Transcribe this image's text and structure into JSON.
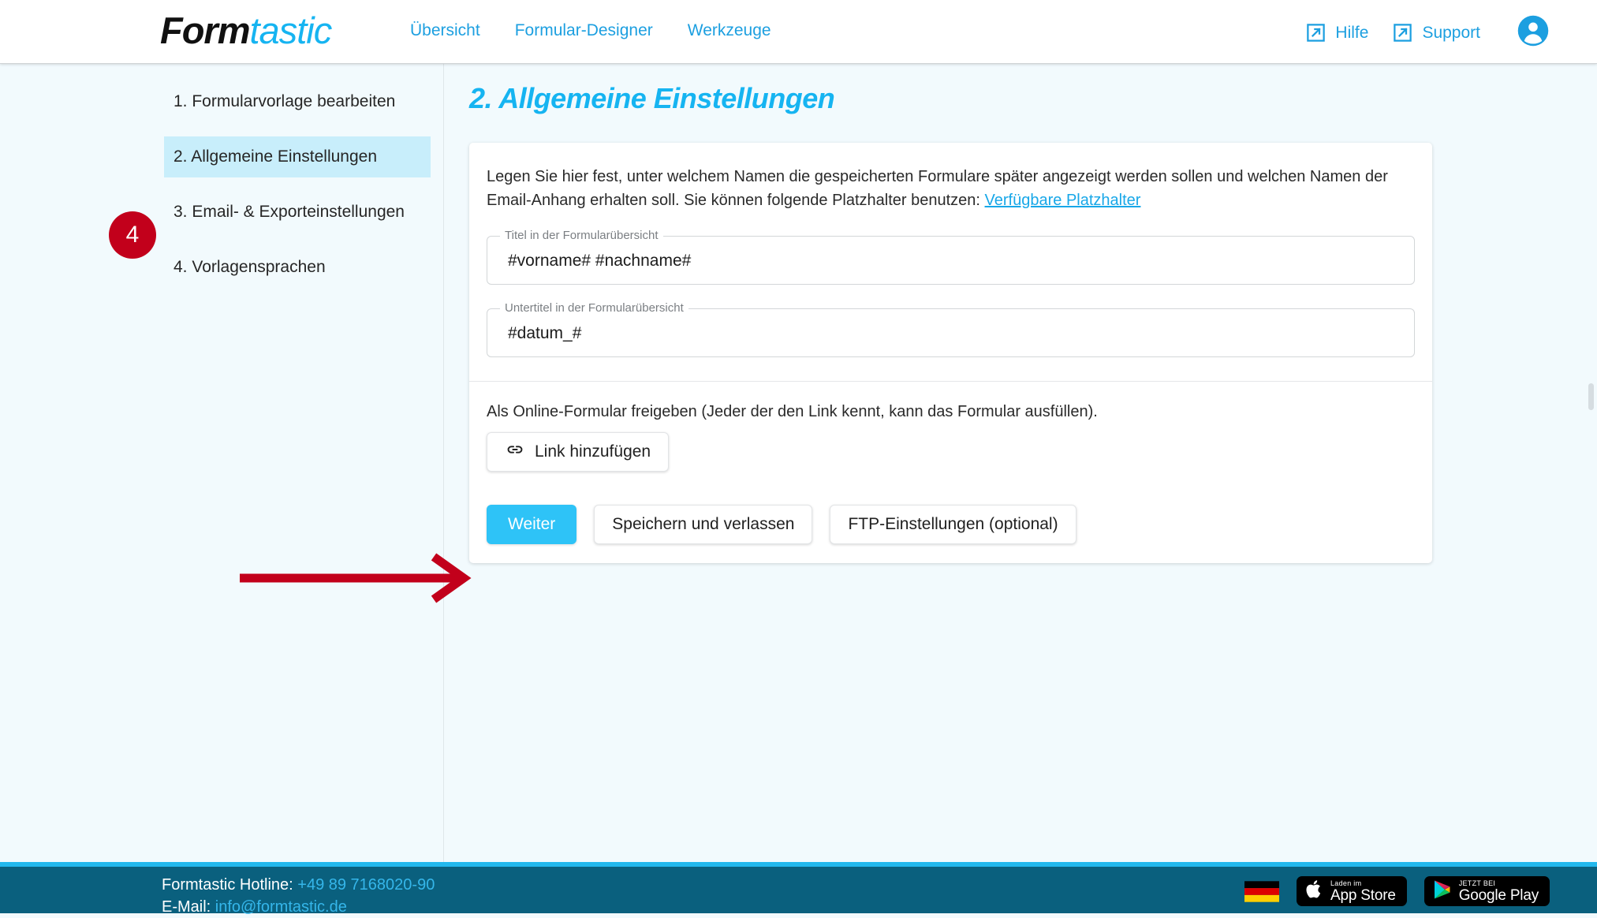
{
  "header": {
    "logo": {
      "part1": "Form",
      "part2": "tastic"
    },
    "nav": [
      {
        "label": "Übersicht",
        "name": "nav-uebersicht"
      },
      {
        "label": "Formular-Designer",
        "name": "nav-formular-designer"
      },
      {
        "label": "Werkzeuge",
        "name": "nav-werkzeuge"
      }
    ],
    "help_label": "Hilfe",
    "support_label": "Support",
    "account_icon": "person-circle-icon",
    "external_link_icon": "external-link-icon"
  },
  "sidebar": {
    "items": [
      {
        "label": "1. Formularvorlage bearbeiten",
        "active": false
      },
      {
        "label": "2. Allgemeine Einstellungen",
        "active": true
      },
      {
        "label": "3. Email- & Exporteinstellungen",
        "active": false
      },
      {
        "label": "4. Vorlagensprachen",
        "active": false
      }
    ],
    "badge": "4"
  },
  "main": {
    "title": "2. Allgemeine Einstellungen",
    "description_part1": "Legen Sie hier fest, unter welchem Namen die gespeicherten Formulare später angezeigt werden sollen und welchen Namen der Email-Anhang erhalten soll. Sie können folgende Platzhalter benutzen: ",
    "description_link": "Verfügbare Platzhalter",
    "fields": [
      {
        "label": "Titel in der Formularübersicht",
        "value": "#vorname# #nachname#",
        "name": "titel-field"
      },
      {
        "label": "Untertitel in der Formularübersicht",
        "value": "#datum_#",
        "name": "untertitel-field"
      }
    ],
    "share_text": "Als Online-Formular freigeben (Jeder der den Link kennt, kann das Formular ausfüllen).",
    "add_link_button": "Link hinzufügen",
    "add_link_icon": "chain-link-icon",
    "buttons": [
      {
        "label": "Weiter",
        "name": "weiter-button",
        "primary": true
      },
      {
        "label": "Speichern und verlassen",
        "name": "speichern-und-verlassen-button",
        "primary": false
      },
      {
        "label": "FTP-Einstellungen (optional)",
        "name": "ftp-einstellungen-button",
        "primary": false
      }
    ]
  },
  "annotation": {
    "arrow_color": "#c2001b",
    "arrow_name": "red-pointer-arrow"
  },
  "footer": {
    "hotline_label": "Formtastic Hotline: ",
    "hotline_value": "+49 89 7168020-90",
    "email_label": "E-Mail: ",
    "email_value": "info@formtastic.de",
    "flag": "german-flag-icon",
    "appstore": {
      "small": "Laden im",
      "big": "App Store"
    },
    "googleplay": {
      "small": "JETZT BEI",
      "big": "Google Play"
    }
  },
  "colors": {
    "accent": "#2ec3f7",
    "link": "#1c9fe0",
    "footer_bg": "#0a607e",
    "badge_red": "#c2001b",
    "page_bg": "#f2fafd"
  }
}
